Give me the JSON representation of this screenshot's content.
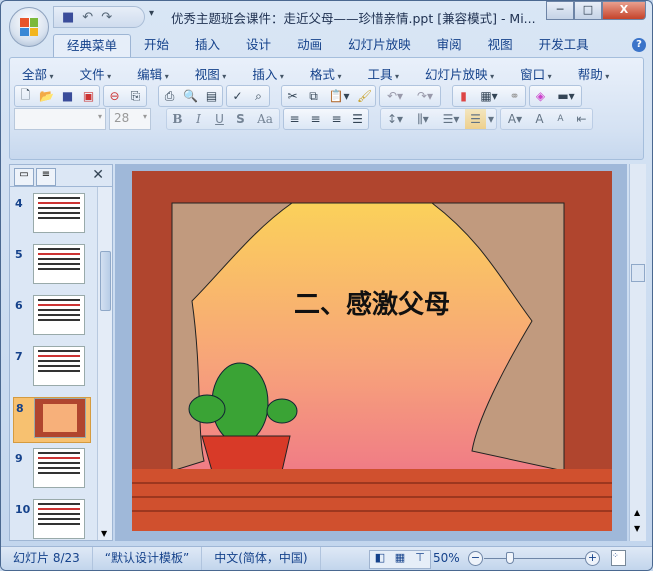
{
  "window": {
    "title": "优秀主题班会课件：走近父母——珍惜亲情.ppt [兼容模式] - Mi...",
    "minimize": "─",
    "maximize": "□",
    "close": "X"
  },
  "qat": {
    "save": "save-icon",
    "undo": "↶",
    "redo": "↷",
    "dropdown": "▾"
  },
  "tabs": [
    {
      "label": "经典菜单",
      "active": true
    },
    {
      "label": "开始"
    },
    {
      "label": "插入"
    },
    {
      "label": "设计"
    },
    {
      "label": "动画"
    },
    {
      "label": "幻灯片放映"
    },
    {
      "label": "审阅"
    },
    {
      "label": "视图"
    },
    {
      "label": "开发工具"
    }
  ],
  "help": "?",
  "menus": [
    "全部",
    "文件",
    "编辑",
    "视图",
    "插入",
    "格式",
    "工具",
    "幻灯片放映",
    "窗口",
    "帮助"
  ],
  "format": {
    "font_size": "28",
    "bold": "B",
    "italic": "I",
    "underline": "U",
    "shadow": "S",
    "change_case": "Aa"
  },
  "thumbnails": [
    {
      "num": "4"
    },
    {
      "num": "5"
    },
    {
      "num": "6"
    },
    {
      "num": "7"
    },
    {
      "num": "8",
      "selected": true
    },
    {
      "num": "9"
    },
    {
      "num": "10"
    }
  ],
  "panel": {
    "close": "✕"
  },
  "slide": {
    "title": "二、感激父母"
  },
  "status": {
    "slide": "幻灯片 8/23",
    "theme": "“默认设计模板”",
    "language": "中文(简体，中国)",
    "zoom": "50%"
  },
  "zoom_percent": 50
}
